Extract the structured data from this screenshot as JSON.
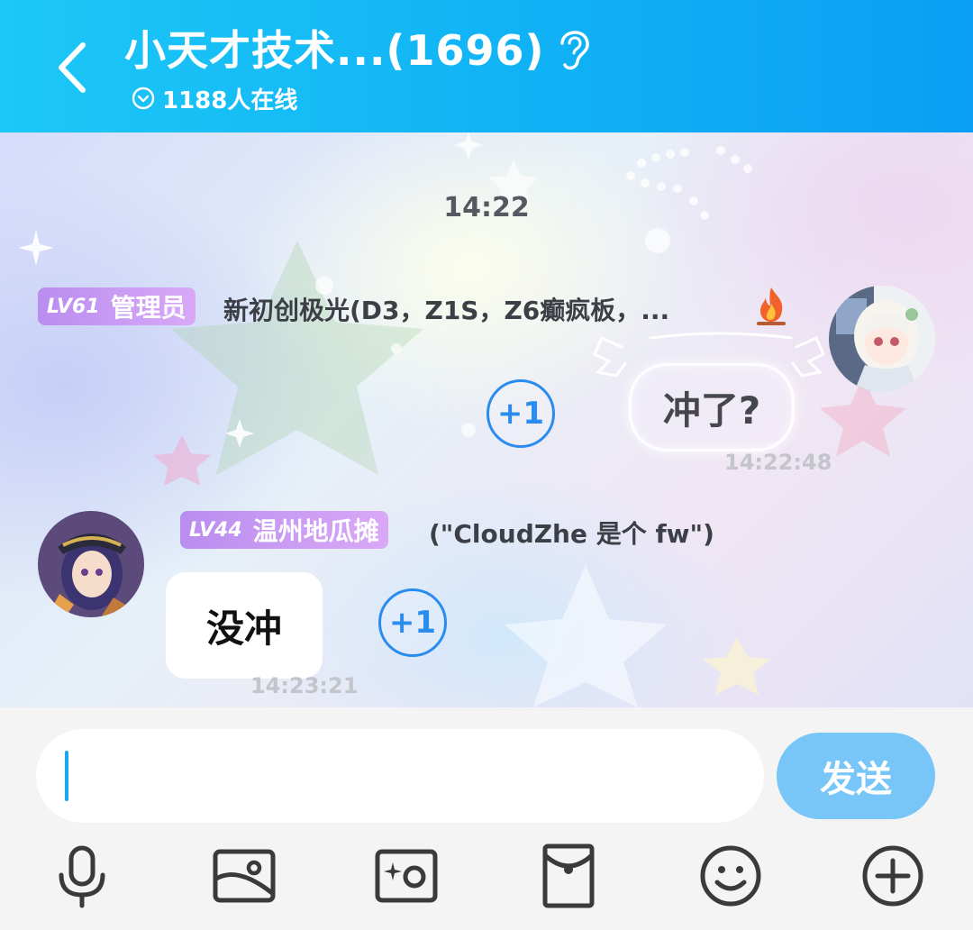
{
  "header": {
    "title": "小天才技术...(1696)",
    "online_text": "1188人在线"
  },
  "chat": {
    "time_divider": "14:22",
    "messages": [
      {
        "side": "right",
        "level": "LV61",
        "role": "管理员",
        "sender": "新初创极光(D3，Z1S，Z6癫疯板，...",
        "text": "冲了?",
        "plus_one": "+1",
        "time": "14:22:48"
      },
      {
        "side": "left",
        "level": "LV44",
        "role": "温州地瓜摊",
        "sender": "(\"CloudZhe 是个 fw\")",
        "text": "没冲",
        "plus_one": "+1",
        "time": "14:23:21"
      }
    ]
  },
  "input": {
    "value": "",
    "send_label": "发送"
  },
  "toolbar": {
    "icons": [
      "microphone-icon",
      "image-icon",
      "camera-icon",
      "red-packet-icon",
      "emoji-icon",
      "plus-icon"
    ]
  },
  "colors": {
    "header_blue": "#12b4f5",
    "badge_purple": "#c79cf3",
    "plus_one_blue": "#2b8cf0",
    "send_button": "#78c6f7"
  }
}
